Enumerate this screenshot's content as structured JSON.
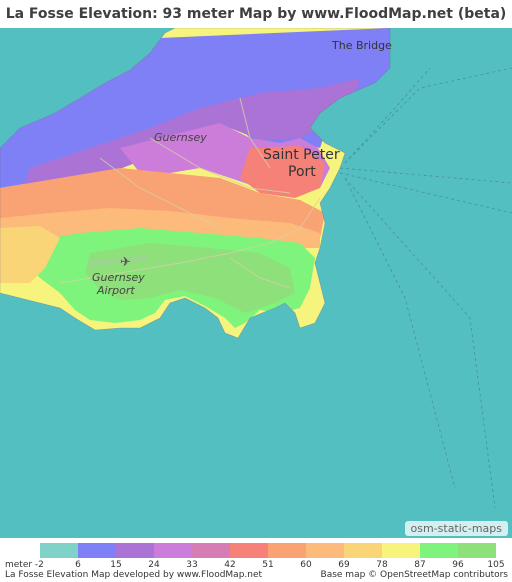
{
  "title": "La Fosse Elevation: 93 meter Map by www.FloodMap.net (beta)",
  "map": {
    "labels": {
      "bridge": "The Bridge",
      "saint_peter_line1": "Saint Peter",
      "saint_peter_line2": "Port",
      "guernsey": "Guernsey",
      "airport_line1": "Guernsey",
      "airport_line2": "Airport"
    },
    "icons": [
      "airport-icon"
    ],
    "attribution": "osm-static-maps",
    "colors": {
      "sea": "#54bfc1",
      "unknown": "#e8e3d6"
    }
  },
  "legend": {
    "unit_label": "meter",
    "ticks": [
      "-2",
      "6",
      "15",
      "24",
      "33",
      "42",
      "51",
      "60",
      "69",
      "78",
      "87",
      "96",
      "105"
    ],
    "colors": [
      "#7fd2c8",
      "#7f7ff6",
      "#ab73d6",
      "#cc7dd9",
      "#d67db5",
      "#f68179",
      "#f9a273",
      "#fcbb7b",
      "#f9d578",
      "#f6f47c",
      "#7ff47c",
      "#8ee07a"
    ]
  },
  "footer": {
    "left": "La Fosse Elevation Map developed by www.FloodMap.net",
    "right": "Base map © OpenStreetMap contributors"
  }
}
